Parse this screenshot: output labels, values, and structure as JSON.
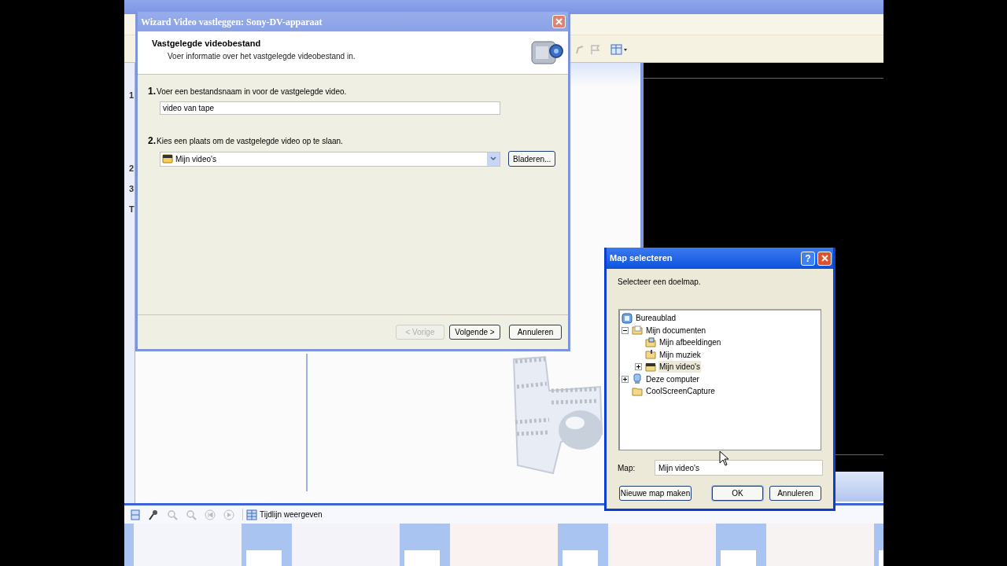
{
  "app": {
    "task_pane_fragments": [
      "1",
      "2",
      "3",
      "T"
    ],
    "timeline_button": "Tijdlijn weergeven"
  },
  "wizard": {
    "title": "Wizard Video vastleggen: Sony-DV-apparaat",
    "header_title": "Vastgelegde videobestand",
    "header_subtitle": "Voer informatie over het vastgelegde videobestand in.",
    "steps": [
      {
        "number": "1.",
        "prompt": "Voer een bestandsnaam in voor de vastgelegde video.",
        "kind": "text",
        "value": "video van tape"
      },
      {
        "number": "2.",
        "prompt": "Kies een plaats om de vastgelegde video op te slaan.",
        "kind": "combo",
        "value": "Mijn video's",
        "button": "Bladeren..."
      }
    ],
    "buttons": [
      {
        "label": "< Vorige",
        "disabled": true
      },
      {
        "label": "Volgende >",
        "disabled": false
      },
      {
        "label": "Annuleren",
        "disabled": false
      }
    ]
  },
  "folder_dialog": {
    "title": "Map selecteren",
    "help": "?",
    "prompt": "Selecteer een doelmap.",
    "tree": [
      {
        "label": "Bureaublad",
        "kind": "desktop",
        "selected": false,
        "children": [
          {
            "label": "Mijn documenten",
            "kind": "documents",
            "selected": false,
            "expanded": true,
            "children": [
              {
                "label": "Mijn afbeeldingen",
                "kind": "pictures",
                "selected": false
              },
              {
                "label": "Mijn muziek",
                "kind": "music",
                "selected": false
              },
              {
                "label": "Mijn video's",
                "kind": "videos",
                "selected": true,
                "expanded": false
              }
            ]
          },
          {
            "label": "Deze computer",
            "kind": "computer",
            "selected": false,
            "expanded": false
          },
          {
            "label": "CoolScreenCapture",
            "kind": "folder",
            "selected": false
          }
        ]
      }
    ],
    "folder_label": "Map:",
    "folder_value": "Mijn video's",
    "buttons": [
      {
        "label": "Nieuwe map maken",
        "default": false
      },
      {
        "label": "OK",
        "default": true
      },
      {
        "label": "Annuleren",
        "default": false
      }
    ]
  }
}
